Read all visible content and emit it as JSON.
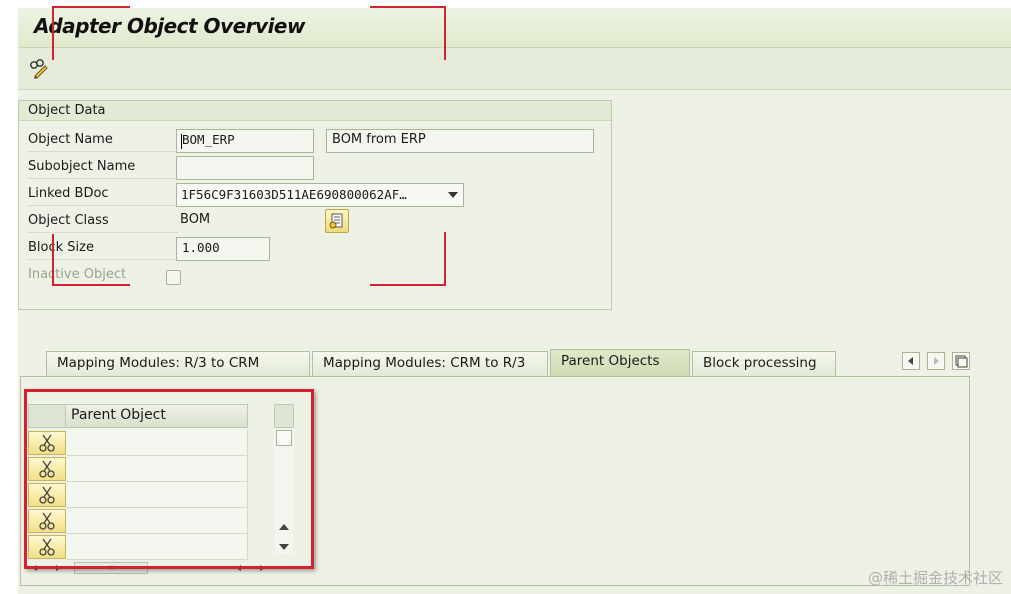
{
  "window": {
    "title": "Adapter Object Overview"
  },
  "toolbar": {
    "edit_icon": "pencil-glasses-icon"
  },
  "object_data": {
    "group_title": "Object Data",
    "object_name_label": "Object Name",
    "object_name_value": "BOM_ERP",
    "object_name_desc": "BOM from ERP",
    "subobject_name_label": "Subobject Name",
    "subobject_name_value": "",
    "linked_bdoc_label": "Linked BDoc",
    "linked_bdoc_value": "1F56C9F31603D511AE690800062AF…",
    "object_class_label": "Object Class",
    "object_class_value": "BOM",
    "block_size_label": "Block Size",
    "block_size_value": "1.000",
    "inactive_object_label": "Inactive Object",
    "inactive_object_checked": false
  },
  "tabs": [
    {
      "label": "Mapping Modules: R/3 to CRM",
      "active": false
    },
    {
      "label": "Mapping Modules: CRM to R/3",
      "active": false
    },
    {
      "label": "Parent Objects",
      "active": true
    },
    {
      "label": "Block processing",
      "active": false
    }
  ],
  "parent_objects_table": {
    "header": "Parent Object",
    "rows": [
      "",
      "",
      "",
      "",
      ""
    ],
    "hscroll_label": "III"
  },
  "watermark": "@稀土掘金技术社区"
}
